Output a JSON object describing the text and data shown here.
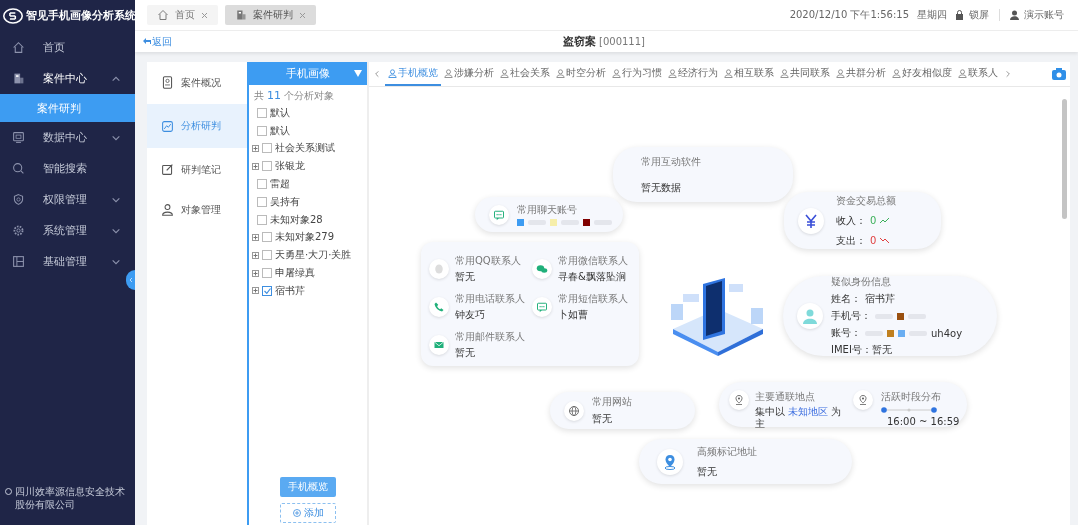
{
  "app": {
    "title": "智见手机画像分析系统",
    "company": "四川效率源信息安全技术股份有限公司"
  },
  "sidebar": {
    "items": [
      {
        "label": "首页"
      },
      {
        "label": "案件中心",
        "expanded": true,
        "children": [
          {
            "label": "案件研判",
            "selected": true
          }
        ]
      },
      {
        "label": "数据中心",
        "expanded": false
      },
      {
        "label": "智能搜索"
      },
      {
        "label": "权限管理",
        "expanded": false
      },
      {
        "label": "系统管理",
        "expanded": false
      },
      {
        "label": "基础管理",
        "expanded": false
      }
    ]
  },
  "top_tabs": [
    {
      "label": "首页",
      "selected": false
    },
    {
      "label": "案件研判",
      "selected": true
    }
  ],
  "header": {
    "datetime": "2020/12/10 下午1:56:15",
    "weekday": "星期四",
    "lock": "锁屏",
    "user": "演示账号"
  },
  "case": {
    "back": "返回",
    "title": "盗窃案",
    "id": "[000111]"
  },
  "case_nav": [
    {
      "label": "案件概况",
      "selected": false
    },
    {
      "label": "分析研判",
      "selected": true
    },
    {
      "label": "研判笔记",
      "selected": false
    },
    {
      "label": "对象管理",
      "selected": false
    }
  ],
  "object_panel": {
    "dropdown": "手机画像",
    "count_prefix": "共",
    "count": "11",
    "count_suffix": "个分析对象",
    "objects": [
      {
        "label": "默认",
        "checked": false
      },
      {
        "label": "默认",
        "checked": false
      },
      {
        "label": "社会关系测试",
        "checked": false,
        "expanded": false
      },
      {
        "label": "张银龙",
        "checked": false,
        "expanded": false
      },
      {
        "label": "雷超",
        "checked": false
      },
      {
        "label": "吴持有",
        "checked": false
      },
      {
        "label": "未知对象28",
        "checked": false
      },
      {
        "label": "未知对象279",
        "checked": false,
        "expanded": false
      },
      {
        "label": "天勇星·大刀·关胜",
        "checked": false,
        "expanded": false
      },
      {
        "label": "申屠绿真",
        "checked": false,
        "expanded": false
      },
      {
        "label": "宿书芹",
        "checked": true,
        "expanded": false
      }
    ],
    "buttons": [
      {
        "label": "手机概览",
        "kind": "primary"
      },
      {
        "label": "添加",
        "kind": "add"
      }
    ]
  },
  "analysis_tabs": [
    {
      "label": "手机概览",
      "selected": true
    },
    {
      "label": "涉嫌分析",
      "selected": false
    },
    {
      "label": "社会关系",
      "selected": false
    },
    {
      "label": "时空分析",
      "selected": false
    },
    {
      "label": "行为习惯",
      "selected": false
    },
    {
      "label": "经济行为",
      "selected": false
    },
    {
      "label": "相互联系",
      "selected": false
    },
    {
      "label": "共同联系",
      "selected": false
    },
    {
      "label": "共群分析",
      "selected": false
    },
    {
      "label": "好友相似度",
      "selected": false
    },
    {
      "label": "联系人",
      "selected": false
    }
  ],
  "overview": {
    "interactive_software": {
      "title": "常用互动软件",
      "value": "暂无数据"
    },
    "chat_accounts": {
      "title": "常用聊天账号"
    },
    "finance": {
      "title": "资金交易总额",
      "income_label": "收入：",
      "income": "0",
      "expense_label": "支出：",
      "expense": "0"
    },
    "contacts": [
      {
        "title": "常用QQ联系人",
        "value": "暂无"
      },
      {
        "title": "常用微信联系人",
        "value": "寻春&飘落坠涧"
      },
      {
        "title": "常用电话联系人",
        "value": "钟友巧"
      },
      {
        "title": "常用短信联系人",
        "value": "卜如曹"
      },
      {
        "title": "常用邮件联系人",
        "value": "暂无"
      }
    ],
    "identity": {
      "title": "疑似身份信息",
      "name_label": "姓名：",
      "name": "宿书芹",
      "phone_label": "手机号：",
      "account_label": "账号：",
      "account_tail": "uh4oy",
      "imei": "IMEI号：暂无"
    },
    "website": {
      "title": "常用网站",
      "value": "暂无"
    },
    "location": {
      "title": "主要通联地点",
      "prefix": "集中以",
      "place": "未知地区",
      "suffix": "为主"
    },
    "active_time": {
      "title": "活跃时段分布",
      "range": "16:00 ~ 16:59"
    },
    "marked_address": {
      "title": "高频标记地址",
      "value": "暂无"
    }
  }
}
